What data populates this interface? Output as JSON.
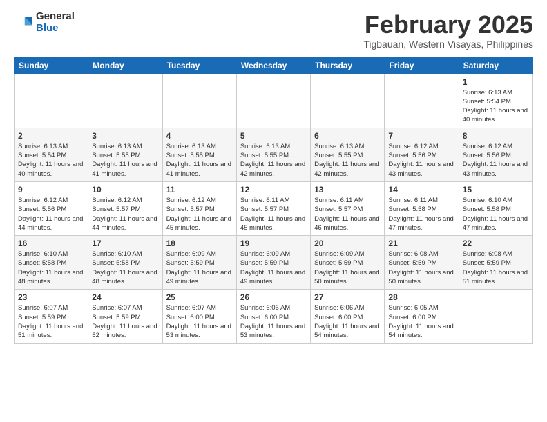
{
  "logo": {
    "general": "General",
    "blue": "Blue"
  },
  "header": {
    "month": "February 2025",
    "location": "Tigbauan, Western Visayas, Philippines"
  },
  "weekdays": [
    "Sunday",
    "Monday",
    "Tuesday",
    "Wednesday",
    "Thursday",
    "Friday",
    "Saturday"
  ],
  "weeks": [
    [
      {
        "day": "",
        "sunrise": "",
        "sunset": "",
        "daylight": ""
      },
      {
        "day": "",
        "sunrise": "",
        "sunset": "",
        "daylight": ""
      },
      {
        "day": "",
        "sunrise": "",
        "sunset": "",
        "daylight": ""
      },
      {
        "day": "",
        "sunrise": "",
        "sunset": "",
        "daylight": ""
      },
      {
        "day": "",
        "sunrise": "",
        "sunset": "",
        "daylight": ""
      },
      {
        "day": "",
        "sunrise": "",
        "sunset": "",
        "daylight": ""
      },
      {
        "day": "1",
        "sunrise": "Sunrise: 6:13 AM",
        "sunset": "Sunset: 5:54 PM",
        "daylight": "Daylight: 11 hours and 40 minutes."
      }
    ],
    [
      {
        "day": "2",
        "sunrise": "Sunrise: 6:13 AM",
        "sunset": "Sunset: 5:54 PM",
        "daylight": "Daylight: 11 hours and 40 minutes."
      },
      {
        "day": "3",
        "sunrise": "Sunrise: 6:13 AM",
        "sunset": "Sunset: 5:55 PM",
        "daylight": "Daylight: 11 hours and 41 minutes."
      },
      {
        "day": "4",
        "sunrise": "Sunrise: 6:13 AM",
        "sunset": "Sunset: 5:55 PM",
        "daylight": "Daylight: 11 hours and 41 minutes."
      },
      {
        "day": "5",
        "sunrise": "Sunrise: 6:13 AM",
        "sunset": "Sunset: 5:55 PM",
        "daylight": "Daylight: 11 hours and 42 minutes."
      },
      {
        "day": "6",
        "sunrise": "Sunrise: 6:13 AM",
        "sunset": "Sunset: 5:55 PM",
        "daylight": "Daylight: 11 hours and 42 minutes."
      },
      {
        "day": "7",
        "sunrise": "Sunrise: 6:12 AM",
        "sunset": "Sunset: 5:56 PM",
        "daylight": "Daylight: 11 hours and 43 minutes."
      },
      {
        "day": "8",
        "sunrise": "Sunrise: 6:12 AM",
        "sunset": "Sunset: 5:56 PM",
        "daylight": "Daylight: 11 hours and 43 minutes."
      }
    ],
    [
      {
        "day": "9",
        "sunrise": "Sunrise: 6:12 AM",
        "sunset": "Sunset: 5:56 PM",
        "daylight": "Daylight: 11 hours and 44 minutes."
      },
      {
        "day": "10",
        "sunrise": "Sunrise: 6:12 AM",
        "sunset": "Sunset: 5:57 PM",
        "daylight": "Daylight: 11 hours and 44 minutes."
      },
      {
        "day": "11",
        "sunrise": "Sunrise: 6:12 AM",
        "sunset": "Sunset: 5:57 PM",
        "daylight": "Daylight: 11 hours and 45 minutes."
      },
      {
        "day": "12",
        "sunrise": "Sunrise: 6:11 AM",
        "sunset": "Sunset: 5:57 PM",
        "daylight": "Daylight: 11 hours and 45 minutes."
      },
      {
        "day": "13",
        "sunrise": "Sunrise: 6:11 AM",
        "sunset": "Sunset: 5:57 PM",
        "daylight": "Daylight: 11 hours and 46 minutes."
      },
      {
        "day": "14",
        "sunrise": "Sunrise: 6:11 AM",
        "sunset": "Sunset: 5:58 PM",
        "daylight": "Daylight: 11 hours and 47 minutes."
      },
      {
        "day": "15",
        "sunrise": "Sunrise: 6:10 AM",
        "sunset": "Sunset: 5:58 PM",
        "daylight": "Daylight: 11 hours and 47 minutes."
      }
    ],
    [
      {
        "day": "16",
        "sunrise": "Sunrise: 6:10 AM",
        "sunset": "Sunset: 5:58 PM",
        "daylight": "Daylight: 11 hours and 48 minutes."
      },
      {
        "day": "17",
        "sunrise": "Sunrise: 6:10 AM",
        "sunset": "Sunset: 5:58 PM",
        "daylight": "Daylight: 11 hours and 48 minutes."
      },
      {
        "day": "18",
        "sunrise": "Sunrise: 6:09 AM",
        "sunset": "Sunset: 5:59 PM",
        "daylight": "Daylight: 11 hours and 49 minutes."
      },
      {
        "day": "19",
        "sunrise": "Sunrise: 6:09 AM",
        "sunset": "Sunset: 5:59 PM",
        "daylight": "Daylight: 11 hours and 49 minutes."
      },
      {
        "day": "20",
        "sunrise": "Sunrise: 6:09 AM",
        "sunset": "Sunset: 5:59 PM",
        "daylight": "Daylight: 11 hours and 50 minutes."
      },
      {
        "day": "21",
        "sunrise": "Sunrise: 6:08 AM",
        "sunset": "Sunset: 5:59 PM",
        "daylight": "Daylight: 11 hours and 50 minutes."
      },
      {
        "day": "22",
        "sunrise": "Sunrise: 6:08 AM",
        "sunset": "Sunset: 5:59 PM",
        "daylight": "Daylight: 11 hours and 51 minutes."
      }
    ],
    [
      {
        "day": "23",
        "sunrise": "Sunrise: 6:07 AM",
        "sunset": "Sunset: 5:59 PM",
        "daylight": "Daylight: 11 hours and 51 minutes."
      },
      {
        "day": "24",
        "sunrise": "Sunrise: 6:07 AM",
        "sunset": "Sunset: 5:59 PM",
        "daylight": "Daylight: 11 hours and 52 minutes."
      },
      {
        "day": "25",
        "sunrise": "Sunrise: 6:07 AM",
        "sunset": "Sunset: 6:00 PM",
        "daylight": "Daylight: 11 hours and 53 minutes."
      },
      {
        "day": "26",
        "sunrise": "Sunrise: 6:06 AM",
        "sunset": "Sunset: 6:00 PM",
        "daylight": "Daylight: 11 hours and 53 minutes."
      },
      {
        "day": "27",
        "sunrise": "Sunrise: 6:06 AM",
        "sunset": "Sunset: 6:00 PM",
        "daylight": "Daylight: 11 hours and 54 minutes."
      },
      {
        "day": "28",
        "sunrise": "Sunrise: 6:05 AM",
        "sunset": "Sunset: 6:00 PM",
        "daylight": "Daylight: 11 hours and 54 minutes."
      },
      {
        "day": "",
        "sunrise": "",
        "sunset": "",
        "daylight": ""
      }
    ]
  ]
}
